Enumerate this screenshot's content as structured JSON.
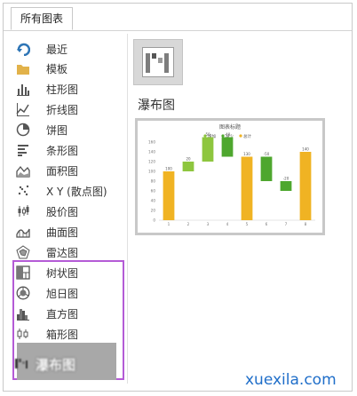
{
  "tab": {
    "label": "所有图表"
  },
  "sidebar": {
    "items": [
      {
        "label": "最近",
        "icon": "recent-icon"
      },
      {
        "label": "模板",
        "icon": "folder-icon"
      },
      {
        "label": "柱形图",
        "icon": "column-chart-icon"
      },
      {
        "label": "折线图",
        "icon": "line-chart-icon"
      },
      {
        "label": "饼图",
        "icon": "pie-chart-icon"
      },
      {
        "label": "条形图",
        "icon": "bar-chart-icon"
      },
      {
        "label": "面积图",
        "icon": "area-chart-icon"
      },
      {
        "label": "X Y (散点图)",
        "icon": "scatter-chart-icon"
      },
      {
        "label": "股价图",
        "icon": "stock-chart-icon"
      },
      {
        "label": "曲面图",
        "icon": "surface-chart-icon"
      },
      {
        "label": "雷达图",
        "icon": "radar-chart-icon"
      },
      {
        "label": "树状图",
        "icon": "treemap-chart-icon"
      },
      {
        "label": "旭日图",
        "icon": "sunburst-chart-icon"
      },
      {
        "label": "直方图",
        "icon": "histogram-chart-icon"
      },
      {
        "label": "箱形图",
        "icon": "box-whisker-chart-icon"
      },
      {
        "label": "瀑布图",
        "icon": "waterfall-chart-icon"
      }
    ]
  },
  "main": {
    "section_title": "瀑布图"
  },
  "chart_data": {
    "type": "bar",
    "title": "图表标题",
    "legend": [
      "增加",
      "减少",
      "总计"
    ],
    "legend_placement": "top",
    "categories": [
      "1",
      "2",
      "3",
      "4",
      "5",
      "6",
      "7",
      "8"
    ],
    "values": [
      100,
      20,
      50,
      -40,
      130,
      -50,
      -20,
      140
    ],
    "labels": [
      "100",
      "20",
      "50",
      "-40",
      "130",
      "-50",
      "-20",
      "140"
    ],
    "kinds": [
      "total",
      "increase",
      "increase",
      "decrease",
      "total",
      "decrease",
      "decrease",
      "total"
    ],
    "ylim": [
      0,
      160
    ],
    "yticks": [
      0,
      20,
      40,
      60,
      80,
      100,
      120,
      140,
      160
    ],
    "grid": false
  },
  "colors": {
    "increase": "#8ec63f",
    "decrease": "#4ea72e",
    "total": "#f0b323",
    "highlight": "#b45bd6",
    "watermark": "#1f6ec9"
  },
  "watermark": "xuexila.com"
}
